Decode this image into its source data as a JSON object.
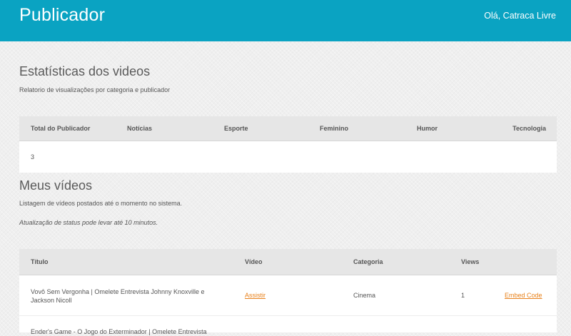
{
  "header": {
    "brand": "Publicador",
    "greeting": "Olá, Catraca Livre",
    "color": "#0aa3c2"
  },
  "stats": {
    "title": "Estatísticas dos videos",
    "description": "Relatorio de visualizações por categoria e publicador",
    "columns": [
      "Total do Publicador",
      "Notícias",
      "Esporte",
      "Feminino",
      "Humor",
      "Tecnologia"
    ],
    "values": [
      "3",
      "",
      "",
      "",
      "",
      ""
    ]
  },
  "videos": {
    "title": "Meus vídeos",
    "description": "Listagem de vídeos postados até o momento no sistema.",
    "note": "Atualização de status pode levar até 10 minutos.",
    "columns": [
      "Título",
      "Vídeo",
      "Categoria",
      "Views",
      ""
    ],
    "rows": [
      {
        "title": "Vovô Sem Vergonha | Omelete Entrevista Johnny Knoxville e Jackson Nicoll",
        "video": "Assistir",
        "category": "Cinema",
        "views": "1",
        "embed": "Embed Code"
      },
      {
        "title": "Ender's Game - O Jogo do Exterminador | Omelete Entrevista",
        "video": "",
        "category": "",
        "views": "",
        "embed": ""
      }
    ]
  },
  "link_color": "#e8811a"
}
